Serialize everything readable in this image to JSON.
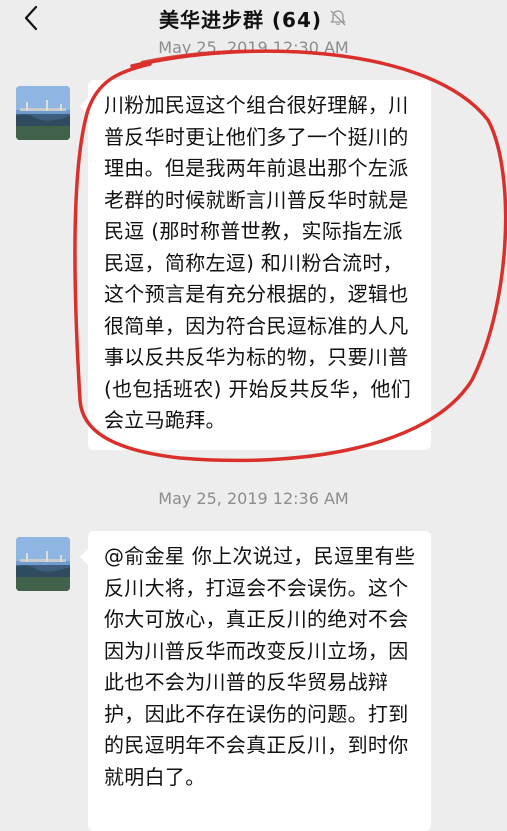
{
  "header": {
    "title": "美华进步群 (64)",
    "back_icon": "chevron-left-icon",
    "mute_icon": "bell-muted-icon"
  },
  "messages": [
    {
      "timestamp": "May 25, 2019 12:30 AM",
      "text": "川粉加民逗这个组合很好理解，川普反华时更让他们多了一个挺川的理由。但是我两年前退出那个左派老群的时候就断言川普反华时就是民逗 (那时称普世教，实际指左派民逗，简称左逗) 和川粉合流时，这个预言是有充分根据的，逻辑也很简单，因为符合民逗标准的人凡事以反共反华为标的物，只要川普 (也包括班农) 开始反共反华，他们会立马跪拜。"
    },
    {
      "timestamp": "May 25, 2019 12:36 AM",
      "text": "@俞金星 你上次说过，民逗里有些反川大将，打逗会不会误伤。这个你大可放心，真正反川的绝对不会因为川普反华而改变反川立场，因此也不会为川普的反华贸易战辩护，因此不存在误伤的问题。打到的民逗明年不会真正反川，到时你就明白了。"
    }
  ],
  "colors": {
    "background": "#ededed",
    "bubble": "#ffffff",
    "annotation": "#d9302b"
  }
}
